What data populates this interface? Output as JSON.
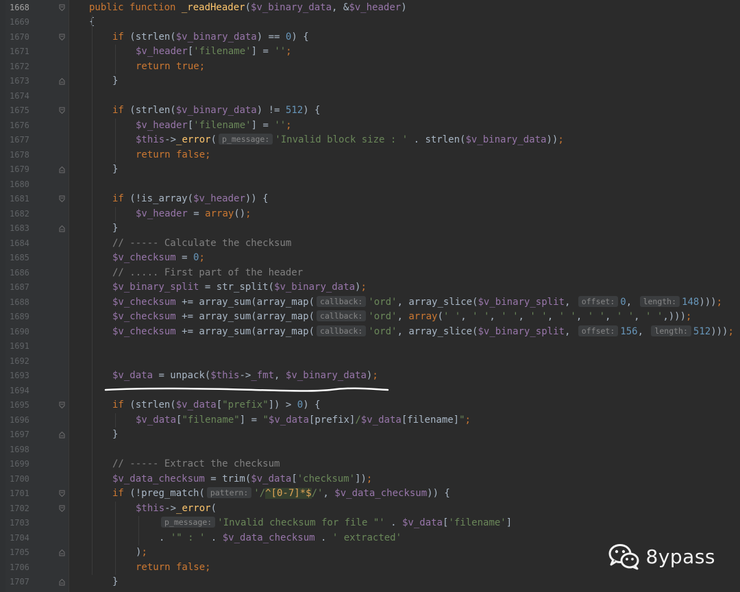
{
  "editor": {
    "lines": [
      {
        "n": "1668",
        "html": "<span class=\"kw\">public function </span><span class=\"fn\">_readHeader</span>(<span class=\"var\">$v_binary_data</span>, &amp;<span class=\"var\">$v_header</span>)",
        "indent": 0,
        "fold": "open"
      },
      {
        "n": "1669",
        "html": "{",
        "indent": 0,
        "fold": ""
      },
      {
        "n": "1670",
        "html": "<span class=\"kw\">if </span>(strlen(<span class=\"var\">$v_binary_data</span>) == <span class=\"num\">0</span>) {",
        "indent": 1,
        "fold": "open"
      },
      {
        "n": "1671",
        "html": "<span class=\"var\">$v_header</span>[<span class=\"str\">'filename'</span>] = <span class=\"str\">''</span><span class=\"kw\">;</span>",
        "indent": 2,
        "fold": ""
      },
      {
        "n": "1672",
        "html": "<span class=\"kw\">return true;</span>",
        "indent": 2,
        "fold": ""
      },
      {
        "n": "1673",
        "html": "}",
        "indent": 1,
        "fold": "close"
      },
      {
        "n": "1674",
        "html": "",
        "indent": 0,
        "fold": ""
      },
      {
        "n": "1675",
        "html": "<span class=\"kw\">if </span>(strlen(<span class=\"var\">$v_binary_data</span>) != <span class=\"num\">512</span>) {",
        "indent": 1,
        "fold": "open"
      },
      {
        "n": "1676",
        "html": "<span class=\"var\">$v_header</span>[<span class=\"str\">'filename'</span>] = <span class=\"str\">''</span><span class=\"kw\">;</span>",
        "indent": 2,
        "fold": ""
      },
      {
        "n": "1677",
        "html": "<span class=\"var\">$this</span>-&gt;<span class=\"fn\">_error</span>(<span class=\"hint\">p_message:</span><span class=\"str\">'Invalid block size : '</span> . strlen(<span class=\"var\">$v_binary_data</span>))<span class=\"kw\">;</span>",
        "indent": 2,
        "fold": ""
      },
      {
        "n": "1678",
        "html": "<span class=\"kw\">return false;</span>",
        "indent": 2,
        "fold": ""
      },
      {
        "n": "1679",
        "html": "}",
        "indent": 1,
        "fold": "close"
      },
      {
        "n": "1680",
        "html": "",
        "indent": 0,
        "fold": ""
      },
      {
        "n": "1681",
        "html": "<span class=\"kw\">if </span>(!is_array(<span class=\"var\">$v_header</span>)) {",
        "indent": 1,
        "fold": "open"
      },
      {
        "n": "1682",
        "html": "<span class=\"var\">$v_header</span> = <span class=\"kw\">array</span>()<span class=\"kw\">;</span>",
        "indent": 2,
        "fold": ""
      },
      {
        "n": "1683",
        "html": "}",
        "indent": 1,
        "fold": "close"
      },
      {
        "n": "1684",
        "html": "<span class=\"cm\">// ----- Calculate the checksum</span>",
        "indent": 1,
        "fold": ""
      },
      {
        "n": "1685",
        "html": "<span class=\"var\">$v_checksum</span> = <span class=\"num\">0</span><span class=\"kw\">;</span>",
        "indent": 1,
        "fold": ""
      },
      {
        "n": "1686",
        "html": "<span class=\"cm\">// ..... First part of the header</span>",
        "indent": 1,
        "fold": ""
      },
      {
        "n": "1687",
        "html": "<span class=\"var\">$v_binary_split</span> = str_split(<span class=\"var\">$v_binary_data</span>)<span class=\"kw\">;</span>",
        "indent": 1,
        "fold": ""
      },
      {
        "n": "1688",
        "html": "<span class=\"var\">$v_checksum</span> += array_sum(array_map(<span class=\"hint\">callback:</span><span class=\"str\">'ord'</span>, array_slice(<span class=\"var\">$v_binary_split</span>, <span class=\"hint\">offset:</span><span class=\"num\">0</span>, <span class=\"hint\">length:</span><span class=\"num\">148</span>)))<span class=\"kw\">;</span>",
        "indent": 1,
        "fold": ""
      },
      {
        "n": "1689",
        "html": "<span class=\"var\">$v_checksum</span> += array_sum(array_map(<span class=\"hint\">callback:</span><span class=\"str\">'ord'</span>, <span class=\"kw\">array</span>(<span class=\"str\">' '</span>, <span class=\"str\">' '</span>, <span class=\"str\">' '</span>, <span class=\"str\">' '</span>, <span class=\"str\">' '</span>, <span class=\"str\">' '</span>, <span class=\"str\">' '</span>, <span class=\"str\">' '</span>,)))<span class=\"kw\">;</span>",
        "indent": 1,
        "fold": ""
      },
      {
        "n": "1690",
        "html": "<span class=\"var\">$v_checksum</span> += array_sum(array_map(<span class=\"hint\">callback:</span><span class=\"str\">'ord'</span>, array_slice(<span class=\"var\">$v_binary_split</span>, <span class=\"hint\">offset:</span><span class=\"num\">156</span>, <span class=\"hint\">length:</span><span class=\"num\">512</span>)))<span class=\"kw\">;</span>",
        "indent": 1,
        "fold": ""
      },
      {
        "n": "1691",
        "html": "",
        "indent": 0,
        "fold": ""
      },
      {
        "n": "1692",
        "html": "",
        "indent": 0,
        "fold": ""
      },
      {
        "n": "1693",
        "html": "<span class=\"var\">$v_data</span> = unpack(<span class=\"var\">$this</span>-&gt;<span class=\"var\">_fmt</span>, <span class=\"var\">$v_binary_data</span>)<span class=\"kw\">;</span>",
        "indent": 1,
        "fold": ""
      },
      {
        "n": "1694",
        "html": "",
        "indent": 0,
        "fold": ""
      },
      {
        "n": "1695",
        "html": "<span class=\"kw\">if </span>(strlen(<span class=\"var\">$v_data</span>[<span class=\"str\">\"prefix\"</span>]) &gt; <span class=\"num\">0</span>) {",
        "indent": 1,
        "fold": "open"
      },
      {
        "n": "1696",
        "html": "<span class=\"var\">$v_data</span>[<span class=\"str\">\"filename\"</span>] = <span class=\"str\">\"</span><span class=\"var\">$v_data</span>[prefix]<span class=\"str\">/</span><span class=\"var\">$v_data</span>[filename]<span class=\"str\">\"</span><span class=\"kw\">;</span>",
        "indent": 2,
        "fold": ""
      },
      {
        "n": "1697",
        "html": "}",
        "indent": 1,
        "fold": "close"
      },
      {
        "n": "1698",
        "html": "",
        "indent": 0,
        "fold": ""
      },
      {
        "n": "1699",
        "html": "<span class=\"cm\">// ----- Extract the checksum</span>",
        "indent": 1,
        "fold": ""
      },
      {
        "n": "1700",
        "html": "<span class=\"var\">$v_data_checksum</span> = trim(<span class=\"var\">$v_data</span>[<span class=\"str\">'checksum'</span>])<span class=\"kw\">;</span>",
        "indent": 1,
        "fold": ""
      },
      {
        "n": "1701",
        "html": "<span class=\"kw\">if </span>(!preg_match(<span class=\"hint\">pattern:</span><span class=\"str\">'/</span><span class=\"rgx\">^[0-7]*$</span><span class=\"str\">/'</span>, <span class=\"var\">$v_data_checksum</span>)) {",
        "indent": 1,
        "fold": "open"
      },
      {
        "n": "1702",
        "html": "<span class=\"var\">$this</span>-&gt;<span class=\"fn\">_error</span>(",
        "indent": 2,
        "fold": "open"
      },
      {
        "n": "1703",
        "html": "<span class=\"hint\">p_message:</span><span class=\"str\">'Invalid checksum for file \"'</span> . <span class=\"var\">$v_data</span>[<span class=\"str\">'filename'</span>]",
        "indent": 3,
        "fold": ""
      },
      {
        "n": "1704",
        "html": ". <span class=\"str\">'\" : '</span> . <span class=\"var\">$v_data_checksum</span> . <span class=\"str\">' extracted'</span>",
        "indent": 3,
        "fold": ""
      },
      {
        "n": "1705",
        "html": ")<span class=\"kw\">;</span>",
        "indent": 2,
        "fold": "close"
      },
      {
        "n": "1706",
        "html": "<span class=\"kw\">return false;</span>",
        "indent": 2,
        "fold": ""
      },
      {
        "n": "1707",
        "html": "}",
        "indent": 1,
        "fold": "close"
      }
    ]
  },
  "watermark": {
    "text": "8ypass",
    "icon": "wechat-icon"
  },
  "colors": {
    "background": "#2b2b2b",
    "keyword": "#cc7832",
    "function": "#ffc66d",
    "variable": "#9876aa",
    "string": "#6a8759",
    "number": "#6897bb",
    "comment": "#808080",
    "underline": "#ffffff"
  }
}
